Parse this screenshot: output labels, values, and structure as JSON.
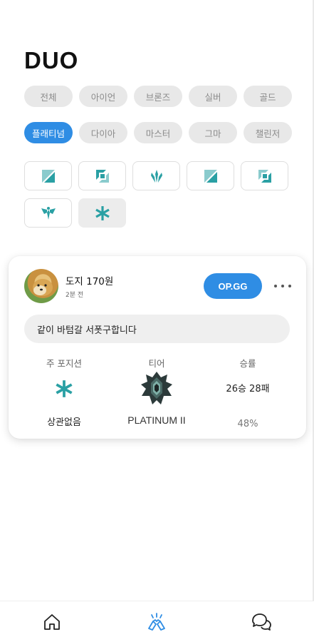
{
  "header": {
    "title": "DUO"
  },
  "tier_filters": [
    "전체",
    "아이언",
    "브론즈",
    "실버",
    "골드",
    "플래티넘",
    "다이아",
    "마스터",
    "그마",
    "챌린저"
  ],
  "active_tier_index": 5,
  "position_filters": [
    {
      "icon": "all-positions-icon",
      "label": ""
    },
    {
      "icon": "top-lane-icon",
      "label": ""
    },
    {
      "icon": "jungle-icon",
      "label": ""
    },
    {
      "icon": "mid-lane-icon",
      "label": ""
    },
    {
      "icon": "bottom-lane-icon",
      "label": ""
    },
    {
      "icon": "support-icon",
      "label": ""
    },
    {
      "icon": "any-position-icon",
      "label": ""
    }
  ],
  "selected_position_index": 6,
  "post": {
    "user_name": "도지 170원",
    "time_ago": "2분 전",
    "opgg_label": "OP.GG",
    "memo": "같이 바텀갈 서폿구합니다",
    "position_header": "주 포지션",
    "position_value": "상관없음",
    "position_icon": "any-position-icon",
    "tier_header": "티어",
    "tier_value": "PLATINUM II",
    "tier_icon": "platinum-emblem-icon",
    "winrate_header": "승률",
    "record": "26승 28패",
    "winrate": "48%"
  },
  "bottom_nav": [
    {
      "icon": "home-icon",
      "active": false
    },
    {
      "icon": "duo-icon",
      "active": true
    },
    {
      "icon": "chat-icon",
      "active": false
    }
  ],
  "colors": {
    "accent": "#2f8de4",
    "position_icon": "#2aa0a4",
    "chip_bg": "#e8e8e8"
  }
}
